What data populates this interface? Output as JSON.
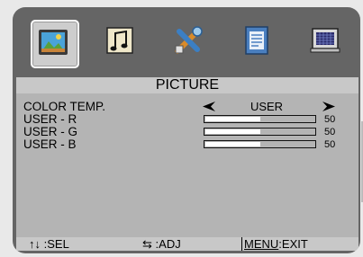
{
  "menu_icons": [
    {
      "name": "picture-icon",
      "selected": true
    },
    {
      "name": "sound-icon",
      "selected": false
    },
    {
      "name": "setup-icon",
      "selected": false
    },
    {
      "name": "features-icon",
      "selected": false
    },
    {
      "name": "screen-icon",
      "selected": false
    }
  ],
  "panel": {
    "title": "PICTURE"
  },
  "color_temp": {
    "label": "COLOR TEMP.",
    "value": "USER"
  },
  "sliders": [
    {
      "label": "USER - R",
      "value": "50",
      "fraction": 0.5
    },
    {
      "label": "USER - G",
      "value": "50",
      "fraction": 0.5
    },
    {
      "label": "USER - B",
      "value": "50",
      "fraction": 0.5
    }
  ],
  "footer": {
    "sel_symbol": "↑↓",
    "sel_label": ":SEL",
    "adj_symbol": "⇆",
    "adj_label": ":ADJ",
    "exit_key": "MENU",
    "exit_label": ":EXIT"
  },
  "colors": {
    "osd_frame": "#656565",
    "panel": "#c8c8c8",
    "content": "#b4b4b4",
    "slider_fill": "#ffffff"
  }
}
